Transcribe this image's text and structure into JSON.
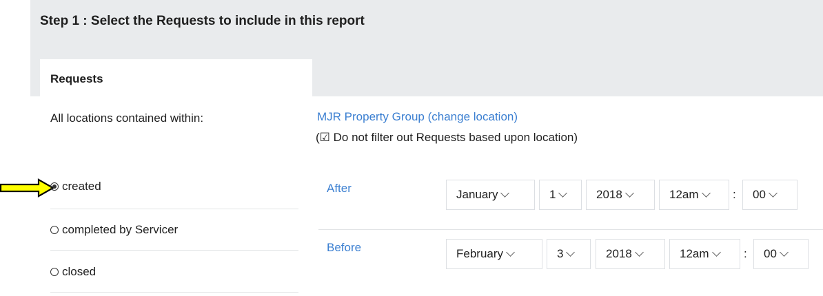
{
  "step_title": "Step 1 : Select the Requests to include in this report",
  "panel_heading": "Requests",
  "location": {
    "label": "All locations contained within:",
    "link": "MJR Property Group (change location)",
    "note_open": "(",
    "note_checkbox": "☑",
    "note_text": " Do not filter out Requests based upon location)"
  },
  "options": [
    {
      "label": "created",
      "selected": true
    },
    {
      "label": "completed by Servicer",
      "selected": false
    },
    {
      "label": "closed",
      "selected": false
    }
  ],
  "after": {
    "label": "After",
    "month": "January",
    "day": "1",
    "year": "2018",
    "hour": "12am",
    "colon": ":",
    "minute": "00"
  },
  "before": {
    "label": "Before",
    "month": "February",
    "day": "3",
    "year": "2018",
    "hour": "12am",
    "colon": ":",
    "minute": "00"
  },
  "icons": {
    "pointer": "yellow-arrow-icon",
    "dropdown": "chevron-down-icon",
    "radio": "radio-icon",
    "checkbox": "checkbox-icon"
  },
  "colors": {
    "link": "#3b7fd1",
    "band": "#e9ebed",
    "arrow_fill": "#ffff00"
  }
}
